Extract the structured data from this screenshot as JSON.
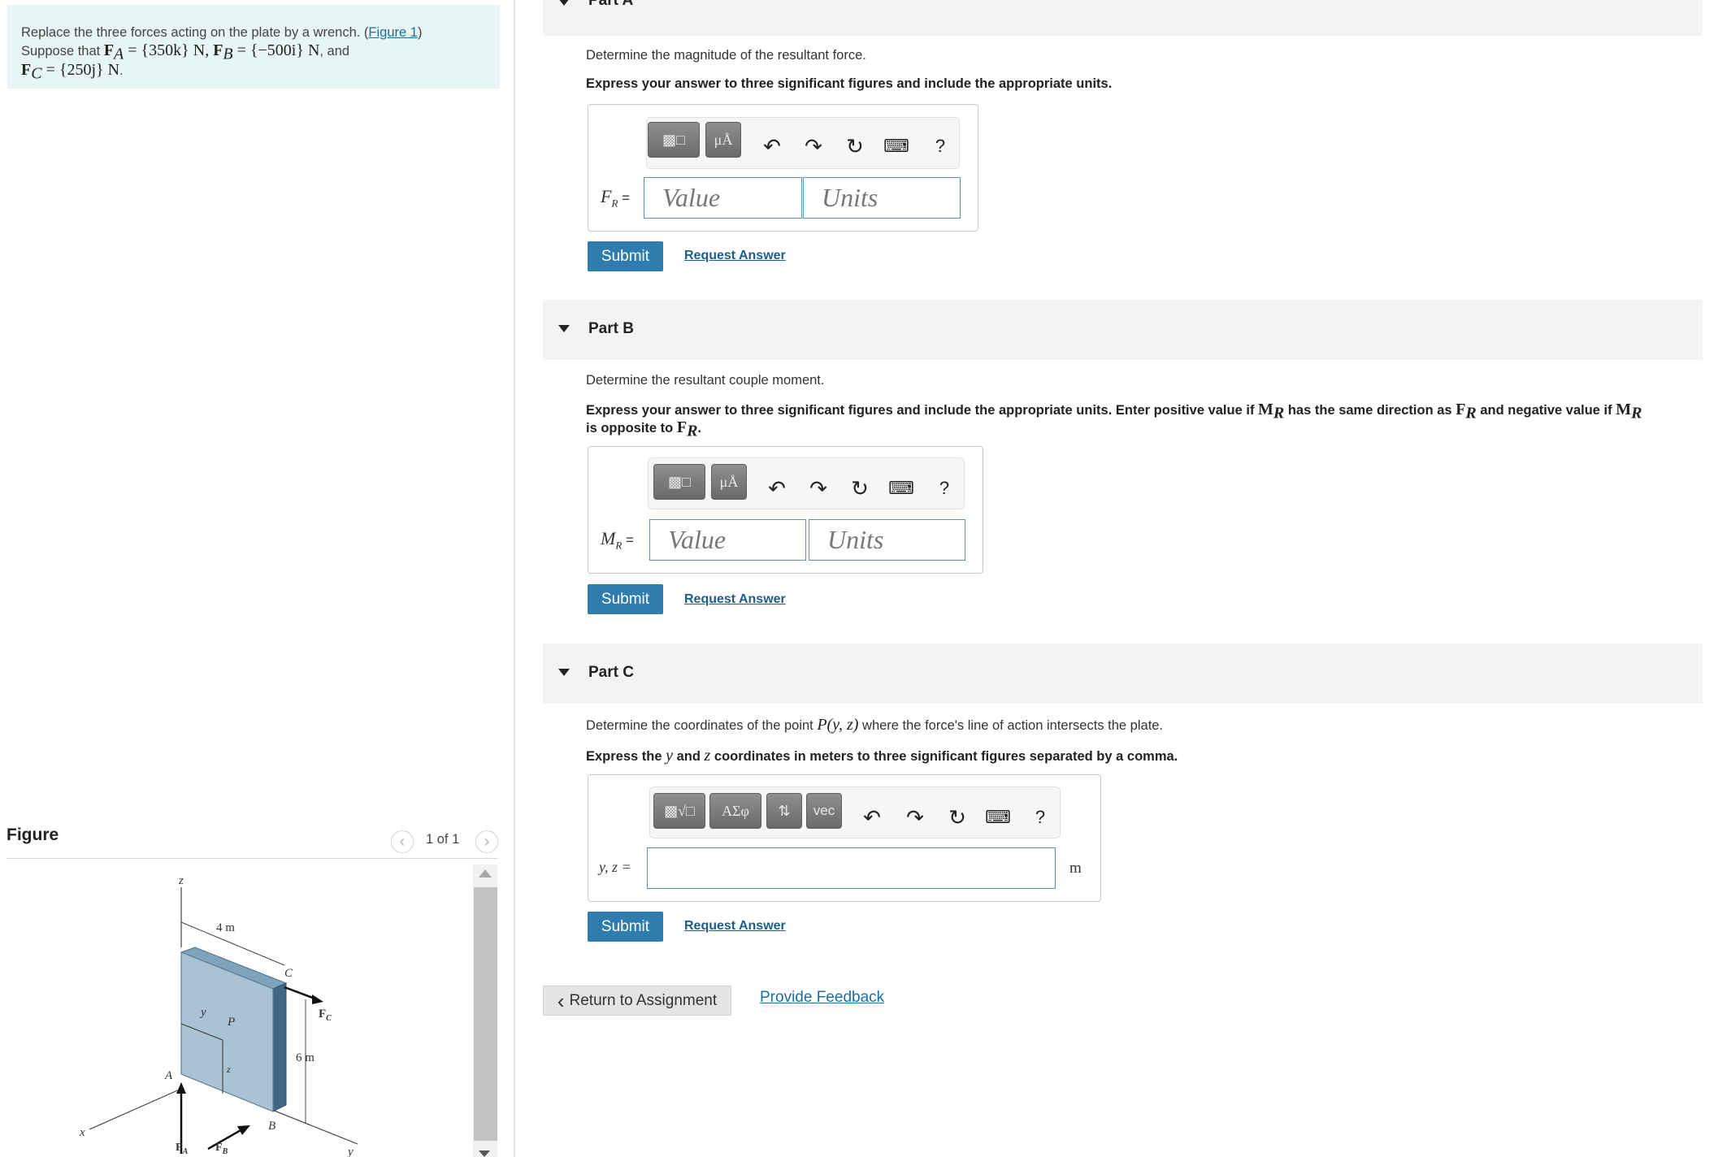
{
  "problem": {
    "line1_text": "Replace the three forces acting on the plate by a wrench. (",
    "figure_link": "Figure 1",
    "line1_close": ")",
    "line2_prefix": "Suppose that ",
    "fa_symbol": "F",
    "fa_sub": "A",
    "fa_value": " = {350k} N, ",
    "fb_symbol": "F",
    "fb_sub": "B",
    "fb_value": " = {−500i} N",
    "and_text": ", and",
    "fc_symbol": "F",
    "fc_sub": "C",
    "fc_value": " = {250j} N",
    "period": "."
  },
  "figure": {
    "title": "Figure",
    "pager": "1 of 1",
    "prev_icon": "chevron-left-icon",
    "next_icon": "chevron-right-icon",
    "labels": {
      "z_axis": "z",
      "x_axis": "x",
      "y_axis": "y",
      "dim_4m": "4 m",
      "dim_6m": "6 m",
      "point_c": "C",
      "point_p": "P",
      "point_a": "A",
      "point_b": "B",
      "inner_y": "y",
      "inner_z": "z",
      "fc_label": "F",
      "fc_sub": "C",
      "fa_label": "F",
      "fa_sub": "A",
      "fb_label": "F",
      "fb_sub": "B"
    }
  },
  "partA": {
    "header_top": "Part A",
    "question": "Determine the magnitude of the resultant force.",
    "instruction": "Express your answer to three significant figures and include the appropriate units.",
    "field_label": "F",
    "field_sub": "R",
    "equals": " =",
    "value_placeholder": "Value",
    "units_placeholder": "Units",
    "submit": "Submit",
    "request": "Request Answer"
  },
  "partB": {
    "header": "Part B",
    "question": "Determine the resultant couple moment.",
    "instruction_1": "Express your answer to three significant figures and include the appropriate units. Enter positive value if ",
    "m_sym": "M",
    "m_sub": "R",
    "instruction_2": " has the same direction as ",
    "f_sym": "F",
    "f_sub": "R",
    "instruction_3": " and negative value if ",
    "m2_sym": "M",
    "m2_sub": "R",
    "instruction_4": "is opposite to ",
    "f2_sym": "F",
    "f2_sub": "R",
    "instruction_end": ".",
    "field_label": "M",
    "field_sub": "R",
    "equals": " =",
    "value_placeholder": "Value",
    "units_placeholder": "Units",
    "submit": "Submit",
    "request": "Request Answer"
  },
  "partC": {
    "header": "Part C",
    "question_1": "Determine the coordinates of the point ",
    "question_math": "P(y, z)",
    "question_2": " where the force's line of action intersects the plate.",
    "instr_1": "Express the ",
    "instr_y": "y",
    "instr_2": " and ",
    "instr_z": "z",
    "instr_3": " coordinates in meters to three significant figures separated by a comma.",
    "field_label": "y, z =",
    "unit": "m",
    "greek_btn": "ΑΣφ",
    "vec_btn": "vec",
    "submit": "Submit",
    "request": "Request Answer"
  },
  "toolbar": {
    "units_btn": "μÅ",
    "undo_icon": "undo-icon",
    "redo_icon": "redo-icon",
    "reset_icon": "reset-icon",
    "keyboard_icon": "keyboard-icon",
    "help": "?"
  },
  "footer": {
    "return": "Return to Assignment",
    "feedback": "Provide Feedback"
  }
}
